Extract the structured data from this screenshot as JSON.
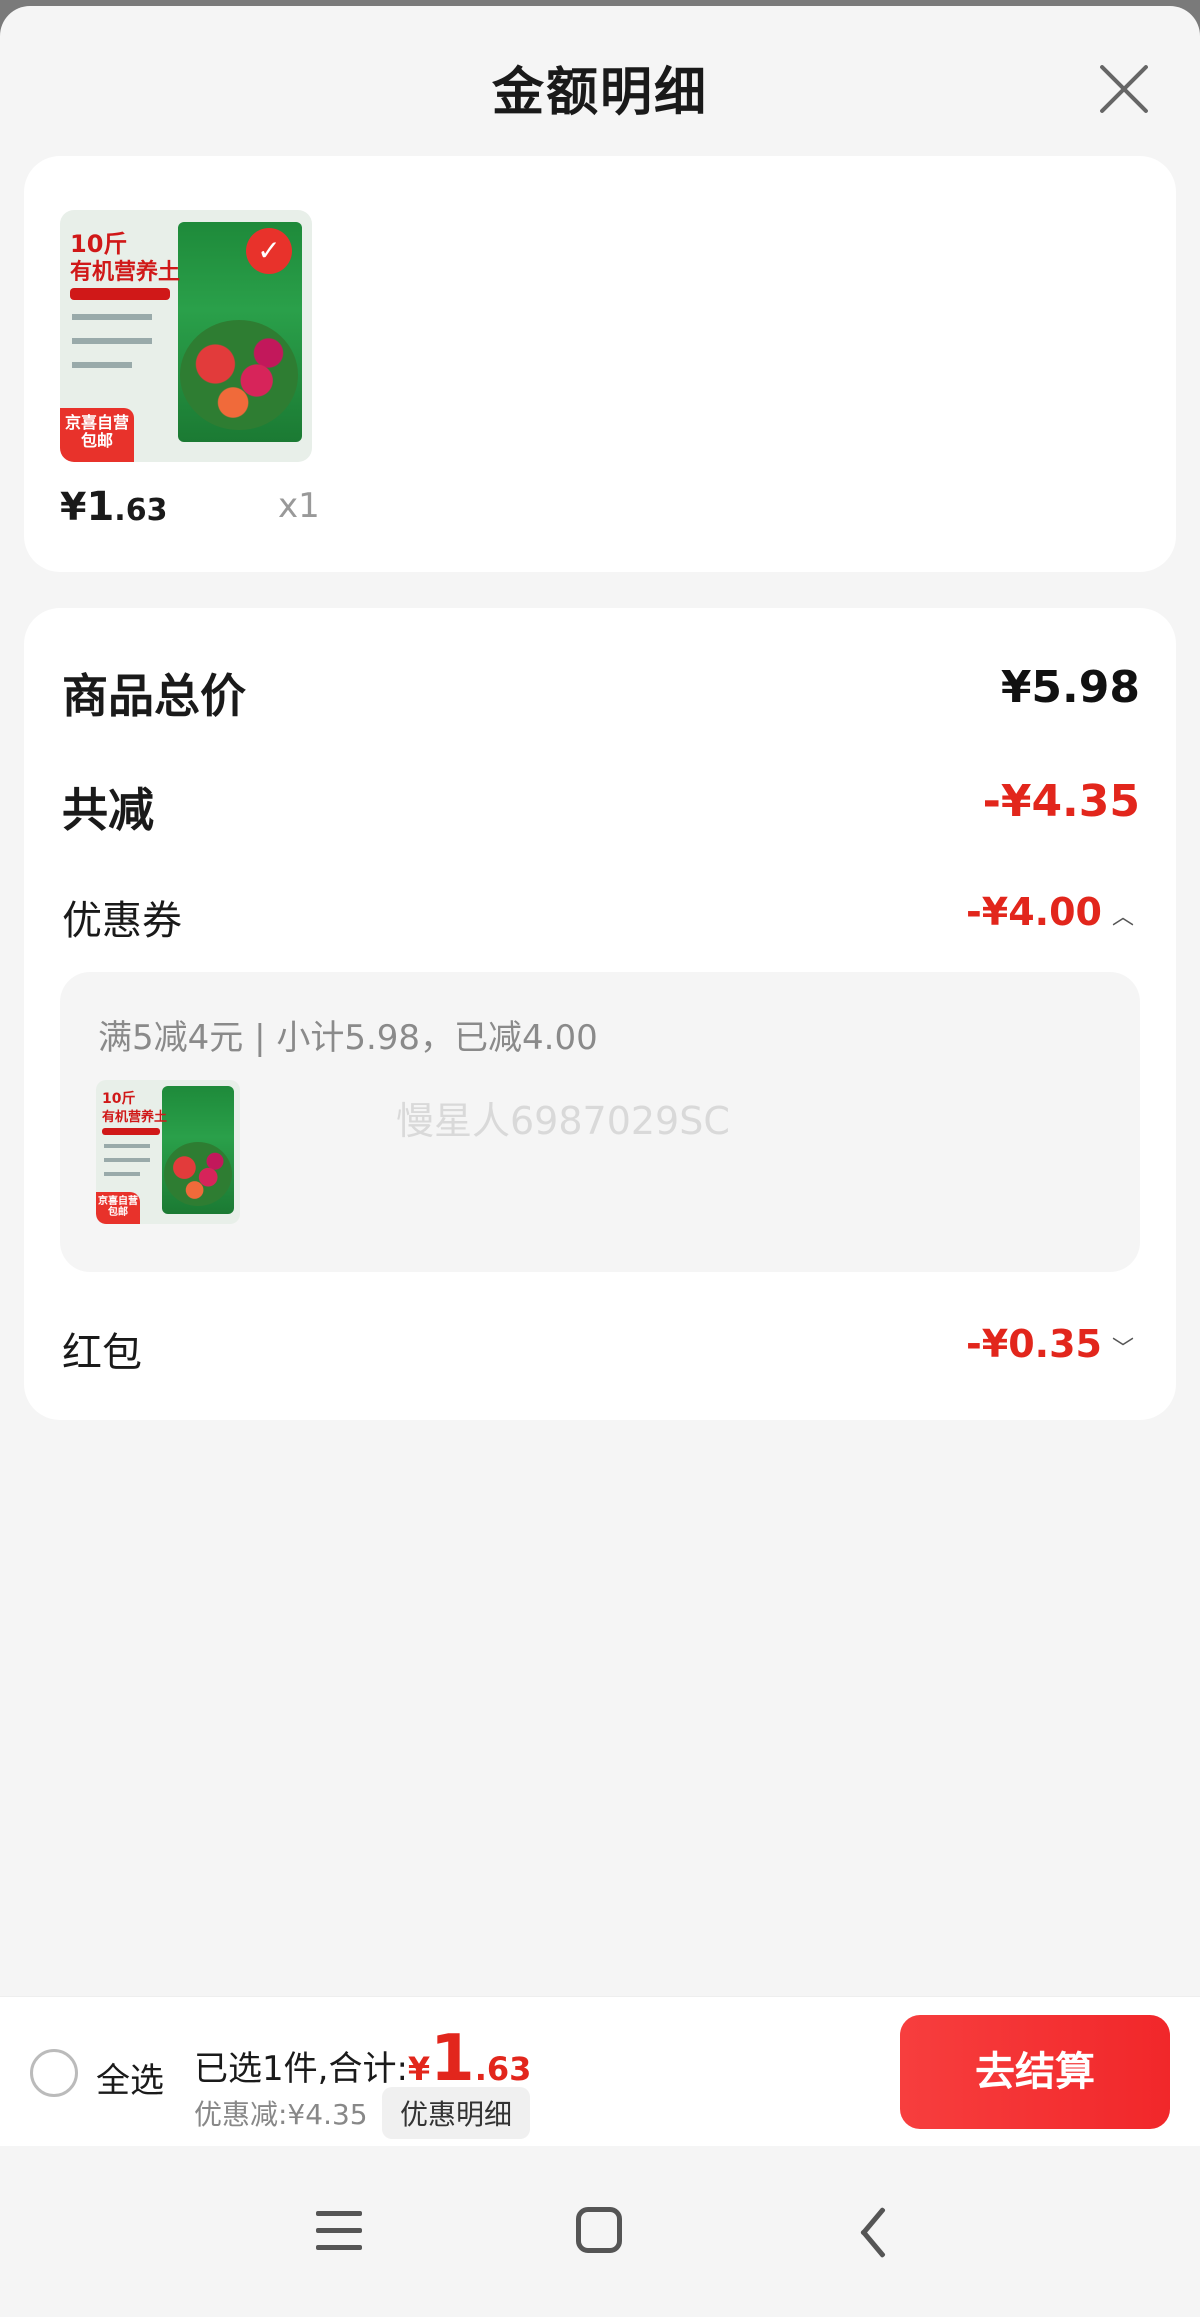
{
  "header": {
    "title": "金额明细"
  },
  "product": {
    "image_text_weight": "10斤",
    "image_text_name": "有机营养土",
    "image_badge": "京喜自营\n包邮",
    "price_yen": "¥",
    "price_int": "1",
    "price_dec": ".63",
    "quantity": "x1"
  },
  "summary": {
    "total_label": "商品总价",
    "total_value": "¥5.98",
    "reduce_label": "共减",
    "reduce_value": "-¥4.35",
    "coupon_label": "优惠券",
    "coupon_value": "-¥4.00",
    "coupon_rule": "满5减4元 | 小计5.98，已减4.00",
    "watermark": "慢星人6987029SC",
    "redpacket_label": "红包",
    "redpacket_value": "-¥0.35"
  },
  "bottom_bar": {
    "select_all": "全选",
    "selected_prefix": "已选1件,合计:",
    "total_yen": "¥",
    "total_int": "1",
    "total_dec": ".63",
    "discount": "优惠减:¥4.35",
    "detail_button": "优惠明细",
    "checkout_button": "去结算"
  },
  "colors": {
    "accent_red": "#e2261c",
    "background": "#f5f5f5"
  }
}
